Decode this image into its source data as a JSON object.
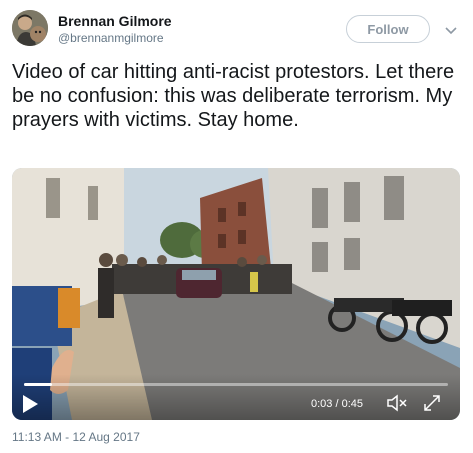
{
  "user": {
    "name": "Brennan Gilmore",
    "handle": "@brennanmgilmore"
  },
  "follow_label": "Follow",
  "tweet_text": "Video of car hitting anti-racist protestors. Let there be no confusion: this was deliberate terrorism. My prayers with victims. Stay home.",
  "video": {
    "current_time": "0:03",
    "duration": "0:45",
    "time_display": "0:03 / 0:45",
    "progress_fraction": 0.067
  },
  "timestamp": "11:13 AM - 12 Aug 2017",
  "icons": [
    "chevron-down-icon",
    "play-icon",
    "mute-icon",
    "fullscreen-icon"
  ],
  "colors": {
    "text": "#14171a",
    "secondary_text": "#657786",
    "follow_border": "#c7d0d8"
  }
}
